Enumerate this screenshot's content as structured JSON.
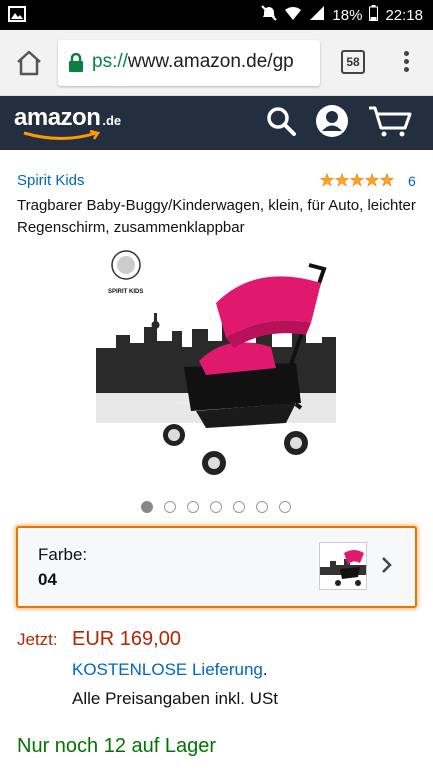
{
  "status_bar": {
    "battery": "18%",
    "time": "22:18"
  },
  "browser": {
    "url_protocol": "ps://",
    "url_rest": "www.amazon.de/gp",
    "tab_count": "58"
  },
  "amazon": {
    "logo_word": "amazon",
    "logo_tld": ".de"
  },
  "product": {
    "brand": "Spirit Kids",
    "rating_count": "6",
    "title": "Tragbarer Baby-Buggy/Kinderwagen, klein, für Auto, leichter Regenschirm, zusammenklappbar",
    "image_logo_text": "SPIRIT KIDS",
    "image_count": 7,
    "active_image": 0
  },
  "variant": {
    "label": "Farbe:",
    "value": "04"
  },
  "pricing": {
    "now_label": "Jetzt:",
    "price": "EUR 169,00",
    "shipping_link": "KOSTENLOSE Lieferung",
    "shipping_suffix": ".",
    "tax_note": "Alle Preisangaben inkl. USt"
  },
  "stock": "Nur noch 12 auf Lager",
  "colors": {
    "amazon_bar": "#232f3e",
    "link": "#0066c0",
    "price": "#b12704",
    "stock": "#007600",
    "accent": "#e77600",
    "star": "#ffa41c"
  }
}
